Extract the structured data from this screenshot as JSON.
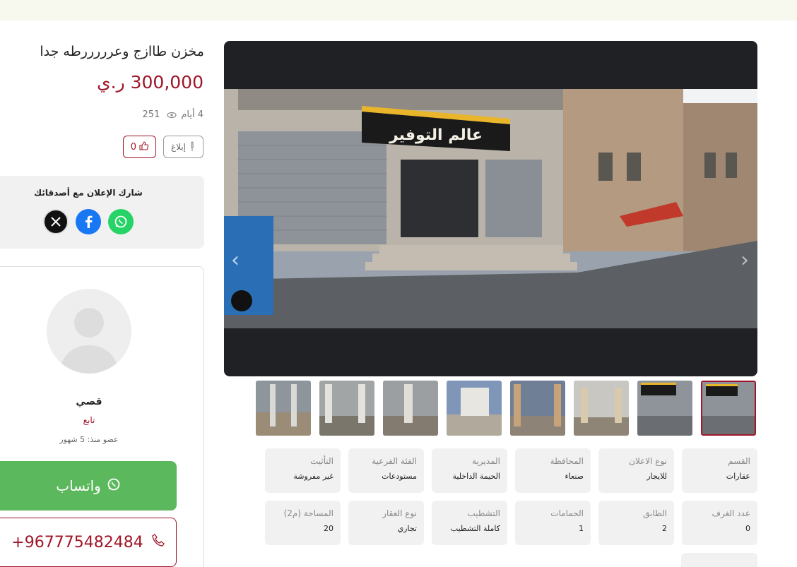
{
  "listing": {
    "title": "مخزن طاازج وعرررررطه جدا",
    "price": "300,000 ر.ي",
    "age": "4 أيام",
    "views": "251",
    "report_label": "إبلاغ",
    "likes": "0"
  },
  "share": {
    "title": "شارك الإعلان مع أصدقائك",
    "networks": [
      "x-icon",
      "facebook-icon",
      "whatsapp-icon"
    ]
  },
  "seller": {
    "name": "قصي",
    "type": "تابع",
    "member_since": "عضو منذ: 5 شهور",
    "whatsapp_label": "واتساب",
    "phone": "+967775482484"
  },
  "details": [
    {
      "label": "القسم",
      "value": "عقارات"
    },
    {
      "label": "نوع الاعلان",
      "value": "للايجار"
    },
    {
      "label": "المحافظة",
      "value": "صنعاء"
    },
    {
      "label": "المديرية",
      "value": "الحيمة الداخلية"
    },
    {
      "label": "الفئة الفرعية",
      "value": "مستودعات"
    },
    {
      "label": "التأثيث",
      "value": "غير مفروشة"
    },
    {
      "label": "عدد الغرف",
      "value": "0"
    },
    {
      "label": "الطابق",
      "value": "2"
    },
    {
      "label": "الحمامات",
      "value": "1"
    },
    {
      "label": "التشطيب",
      "value": "كاملة التشطيب"
    },
    {
      "label": "نوع العقار",
      "value": "تجاري"
    },
    {
      "label": "المساحة (م2)",
      "value": "20"
    }
  ],
  "gallery": {
    "sign_text": "عالم التوفير",
    "thumb_count": 8,
    "active_thumb": 1
  },
  "colors": {
    "accent": "#a01628",
    "whatsapp": "#5cb85c",
    "panel": "#f1f1f1"
  }
}
